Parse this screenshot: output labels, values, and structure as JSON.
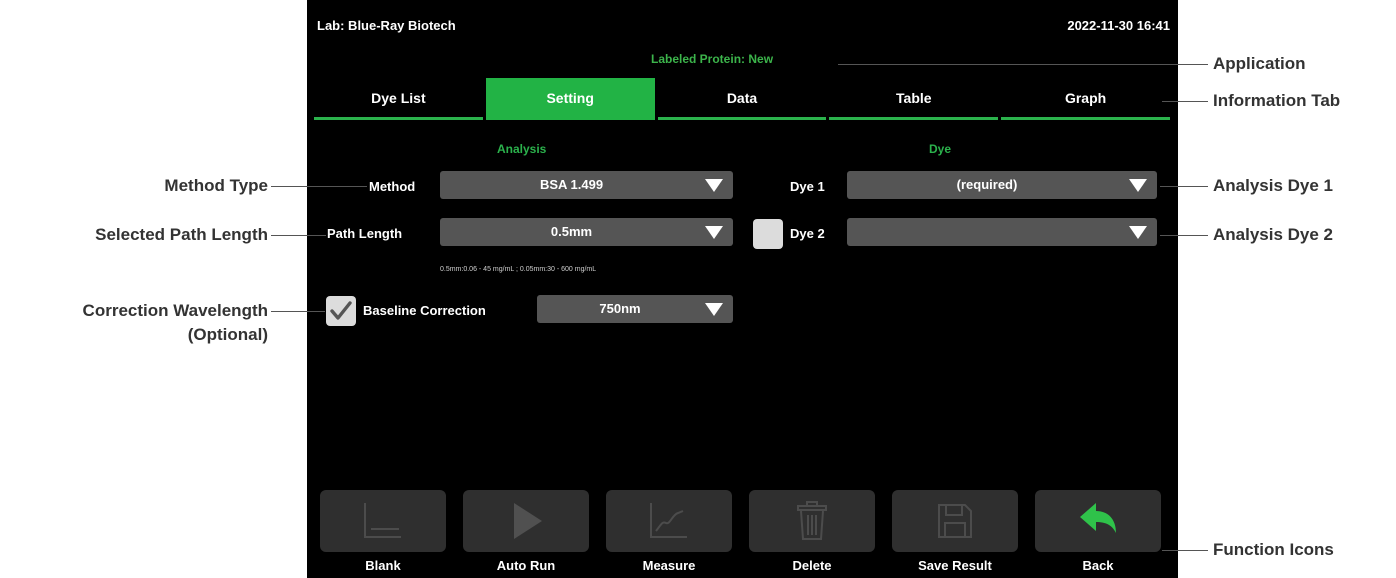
{
  "header": {
    "lab": "Lab: Blue-Ray Biotech",
    "datetime": "2022-11-30 16:41",
    "application": "Labeled Protein: New"
  },
  "tabs": [
    {
      "label": "Dye List",
      "active": false
    },
    {
      "label": "Setting",
      "active": true
    },
    {
      "label": "Data",
      "active": false
    },
    {
      "label": "Table",
      "active": false
    },
    {
      "label": "Graph",
      "active": false
    }
  ],
  "analysis": {
    "title": "Analysis",
    "method_label": "Method",
    "method_value": "BSA 1.499",
    "path_label": "Path Length",
    "path_value": "0.5mm",
    "range_note": "0.5mm:0.06 - 45 mg/mL ; 0.05mm:30 - 600 mg/mL",
    "baseline_label": "Baseline Correction",
    "baseline_checked": true,
    "baseline_value": "750nm"
  },
  "dye": {
    "title": "Dye",
    "dye1_label": "Dye 1",
    "dye1_value": "(required)",
    "dye2_label": "Dye 2",
    "dye2_checked": false,
    "dye2_value": ""
  },
  "functions": [
    {
      "label": "Blank",
      "icon": "blank-baseline-icon",
      "enabled": false
    },
    {
      "label": "Auto Run",
      "icon": "play-icon",
      "enabled": false
    },
    {
      "label": "Measure",
      "icon": "measure-chart-icon",
      "enabled": false
    },
    {
      "label": "Delete",
      "icon": "trash-icon",
      "enabled": false
    },
    {
      "label": "Save Result",
      "icon": "save-disk-icon",
      "enabled": false
    },
    {
      "label": "Back",
      "icon": "back-arrow-icon",
      "enabled": true
    }
  ],
  "callouts": {
    "application": "Application",
    "information_tab": "Information Tab",
    "analysis_dye_1": "Analysis Dye 1",
    "analysis_dye_2": "Analysis Dye 2",
    "function_icons": "Function Icons",
    "method_type": "Method Type",
    "selected_path_length": "Selected Path Length",
    "correction_wavelength_1": "Correction Wavelength",
    "correction_wavelength_2": "(Optional)"
  },
  "colors": {
    "accent_green": "#22b345",
    "app_label_green": "#3cb44b",
    "screen_bg": "#000000",
    "dropdown_bg": "#555555",
    "button_bg": "#2f2f2f",
    "back_arrow": "#2fc24a"
  }
}
